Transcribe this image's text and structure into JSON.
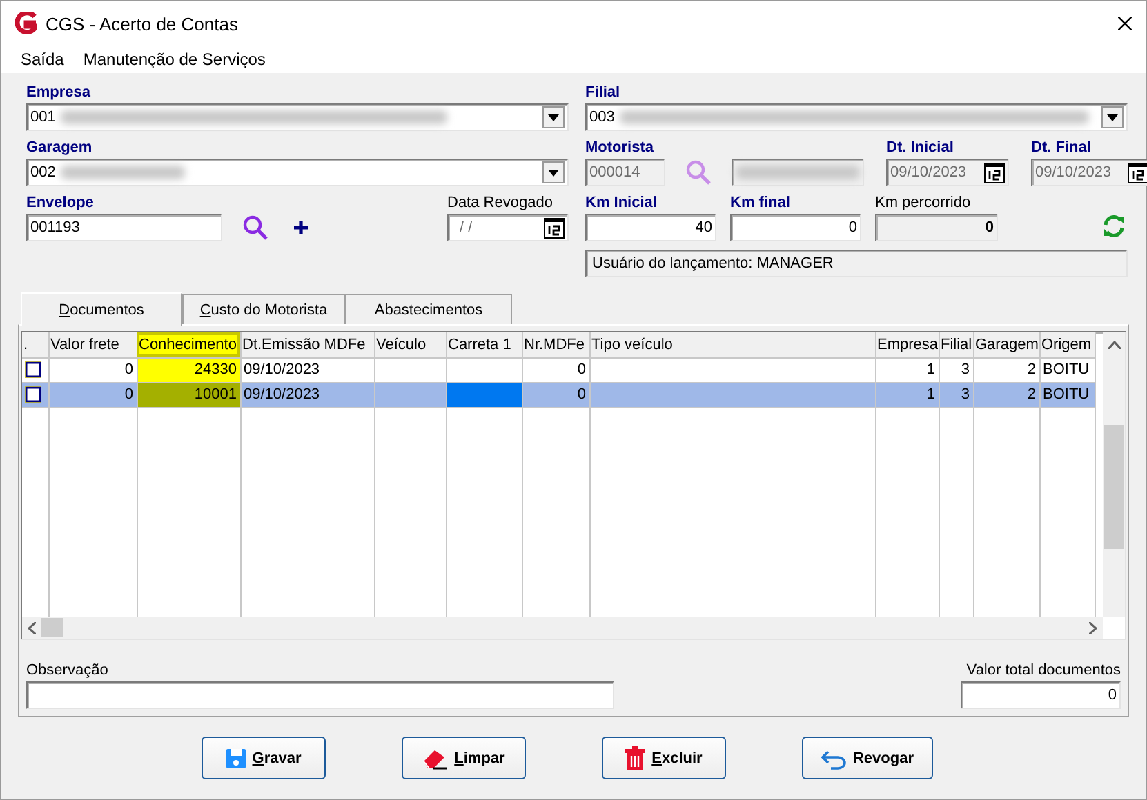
{
  "window": {
    "title": "CGS - Acerto de Contas"
  },
  "menu": [
    {
      "label": "Saída"
    },
    {
      "label": "Manutenção de Serviços"
    }
  ],
  "form": {
    "empresa": {
      "label": "Empresa",
      "value": "001"
    },
    "garagem": {
      "label": "Garagem",
      "value": "002"
    },
    "envelope": {
      "label": "Envelope",
      "value": "001193"
    },
    "data_revogado": {
      "label": "Data Revogado",
      "value": "/ /"
    },
    "filial": {
      "label": "Filial",
      "value": "003"
    },
    "motorista": {
      "label": "Motorista",
      "value": "000014",
      "disabled": true
    },
    "dt_inicial": {
      "label": "Dt. Inicial",
      "value": "09/10/2023",
      "disabled": true
    },
    "dt_final": {
      "label": "Dt. Final",
      "value": "09/10/2023",
      "disabled": true
    },
    "km_inicial": {
      "label": "Km Inicial",
      "value": "40"
    },
    "km_final": {
      "label": "Km final",
      "value": "0"
    },
    "km_percorrido": {
      "label": "Km percorrido",
      "value": "0",
      "disabled": true
    },
    "usuario": "Usuário do lançamento: MANAGER"
  },
  "tabs": [
    {
      "label": "Documentos",
      "selected": true,
      "mnemonic": true
    },
    {
      "label": "Custo do Motorista",
      "selected": false,
      "mnemonic": true
    },
    {
      "label": "Abastecimentos",
      "selected": false,
      "mnemonic": false
    }
  ],
  "table": {
    "columns": [
      {
        "label": ".",
        "highlighted": false
      },
      {
        "label": "Valor frete",
        "highlighted": false
      },
      {
        "label": "Conhecimento",
        "highlighted": true
      },
      {
        "label": "Dt.Emissão MDFe",
        "highlighted": false
      },
      {
        "label": "Veículo",
        "highlighted": false
      },
      {
        "label": "Carreta 1",
        "highlighted": false
      },
      {
        "label": "Nr.MDFe",
        "highlighted": false
      },
      {
        "label": "Tipo veículo",
        "highlighted": false
      },
      {
        "label": "Empresa",
        "highlighted": false
      },
      {
        "label": "Filial",
        "highlighted": false
      },
      {
        "label": "Garagem",
        "highlighted": false
      },
      {
        "label": "Origem",
        "highlighted": false
      }
    ],
    "rows": [
      {
        "selected": false,
        "cells": [
          {
            "focused": false
          },
          {
            "value": "0",
            "focused": false
          },
          {
            "value": "24330",
            "focused": false
          },
          {
            "value": "09/10/2023",
            "focused": false
          },
          {
            "focused": false
          },
          {
            "focused": false
          },
          {
            "value": "0",
            "focused": false
          },
          {
            "focused": false
          },
          {
            "value": "1",
            "focused": false
          },
          {
            "value": "3",
            "focused": false
          },
          {
            "value": "2",
            "focused": false
          },
          {
            "value": "BOITU",
            "focused": false
          }
        ]
      },
      {
        "selected": true,
        "cells": [
          {
            "focused": false
          },
          {
            "value": "0",
            "focused": false
          },
          {
            "value": "10001",
            "focused": false
          },
          {
            "value": "09/10/2023",
            "focused": false
          },
          {
            "focused": false
          },
          {
            "focused": true
          },
          {
            "value": "0",
            "focused": false
          },
          {
            "focused": false
          },
          {
            "value": "1",
            "focused": false
          },
          {
            "value": "3",
            "focused": false
          },
          {
            "value": "2",
            "focused": false
          },
          {
            "value": "BOITU",
            "focused": false
          }
        ]
      }
    ]
  },
  "observacao": {
    "label": "Observação"
  },
  "valor_total": {
    "label": "Valor total documentos",
    "value": "0"
  },
  "buttons": [
    {
      "label": "Gravar",
      "kind": "save",
      "mnemonic": true
    },
    {
      "label": "Limpar",
      "kind": "clear",
      "mnemonic": true
    },
    {
      "label": "Excluir",
      "kind": "delete",
      "mnemonic": true
    },
    {
      "label": "Revogar",
      "kind": "revoke",
      "mnemonic": false
    }
  ]
}
